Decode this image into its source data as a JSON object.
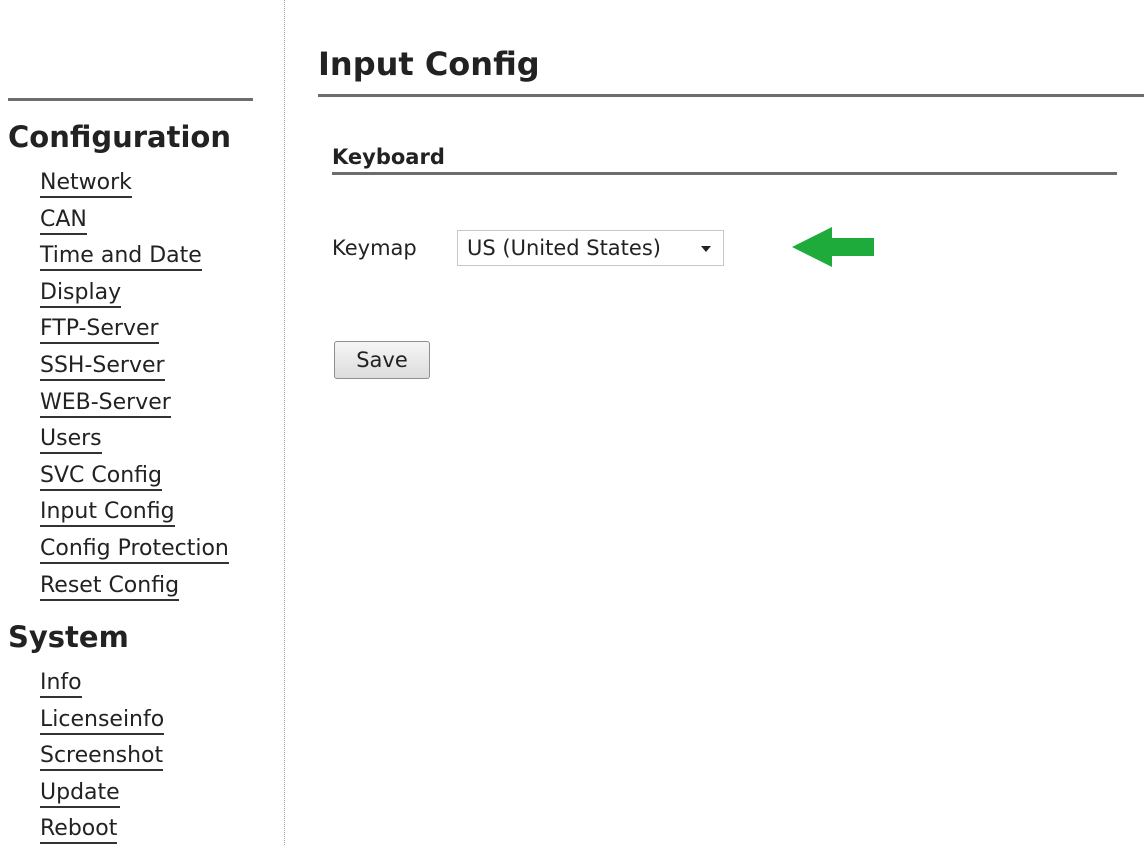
{
  "sidebar": {
    "configuration_heading": "Configuration",
    "configuration_items": [
      {
        "label": "Network"
      },
      {
        "label": "CAN"
      },
      {
        "label": "Time and Date"
      },
      {
        "label": "Display"
      },
      {
        "label": "FTP-Server"
      },
      {
        "label": "SSH-Server"
      },
      {
        "label": "WEB-Server"
      },
      {
        "label": "Users"
      },
      {
        "label": "SVC Config"
      },
      {
        "label": "Input Config"
      },
      {
        "label": "Config Protection"
      },
      {
        "label": "Reset Config"
      }
    ],
    "system_heading": "System",
    "system_items": [
      {
        "label": "Info"
      },
      {
        "label": "Licenseinfo"
      },
      {
        "label": "Screenshot"
      },
      {
        "label": "Update"
      },
      {
        "label": "Reboot"
      }
    ]
  },
  "main": {
    "page_title": "Input Config",
    "section_title": "Keyboard",
    "keymap": {
      "label": "Keymap",
      "selected": "US (United States)"
    },
    "save_label": "Save"
  },
  "icons": {
    "select_caret": "chevron-down-icon",
    "annotation_arrow": "arrow-left-icon"
  },
  "colors": {
    "annotation_arrow": "#1faa3c",
    "rule": "#6d6d6d"
  }
}
